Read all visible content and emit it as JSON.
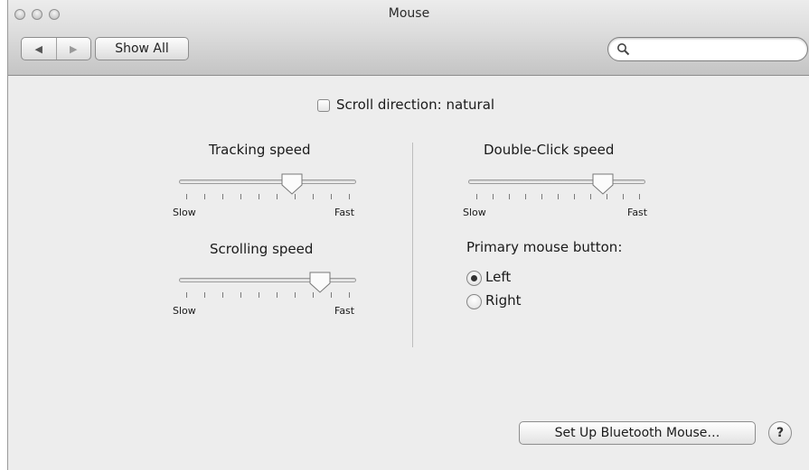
{
  "window": {
    "title": "Mouse"
  },
  "toolbar": {
    "back_icon": "◀",
    "forward_icon": "▶",
    "show_all_label": "Show All",
    "search_placeholder": "",
    "search_value": ""
  },
  "scroll_direction": {
    "label": "Scroll direction: natural",
    "checked": false
  },
  "tracking": {
    "label": "Tracking speed",
    "slow": "Slow",
    "fast": "Fast",
    "value": 0.65
  },
  "scrolling": {
    "label": "Scrolling speed",
    "slow": "Slow",
    "fast": "Fast",
    "value": 0.82
  },
  "double_click": {
    "label": "Double-Click speed",
    "slow": "Slow",
    "fast": "Fast",
    "value": 0.78
  },
  "primary_button": {
    "label": "Primary mouse button:",
    "options": [
      {
        "label": "Left",
        "selected": true
      },
      {
        "label": "Right",
        "selected": false
      }
    ]
  },
  "setup_button_label": "Set Up Bluetooth Mouse…",
  "help_label": "?"
}
